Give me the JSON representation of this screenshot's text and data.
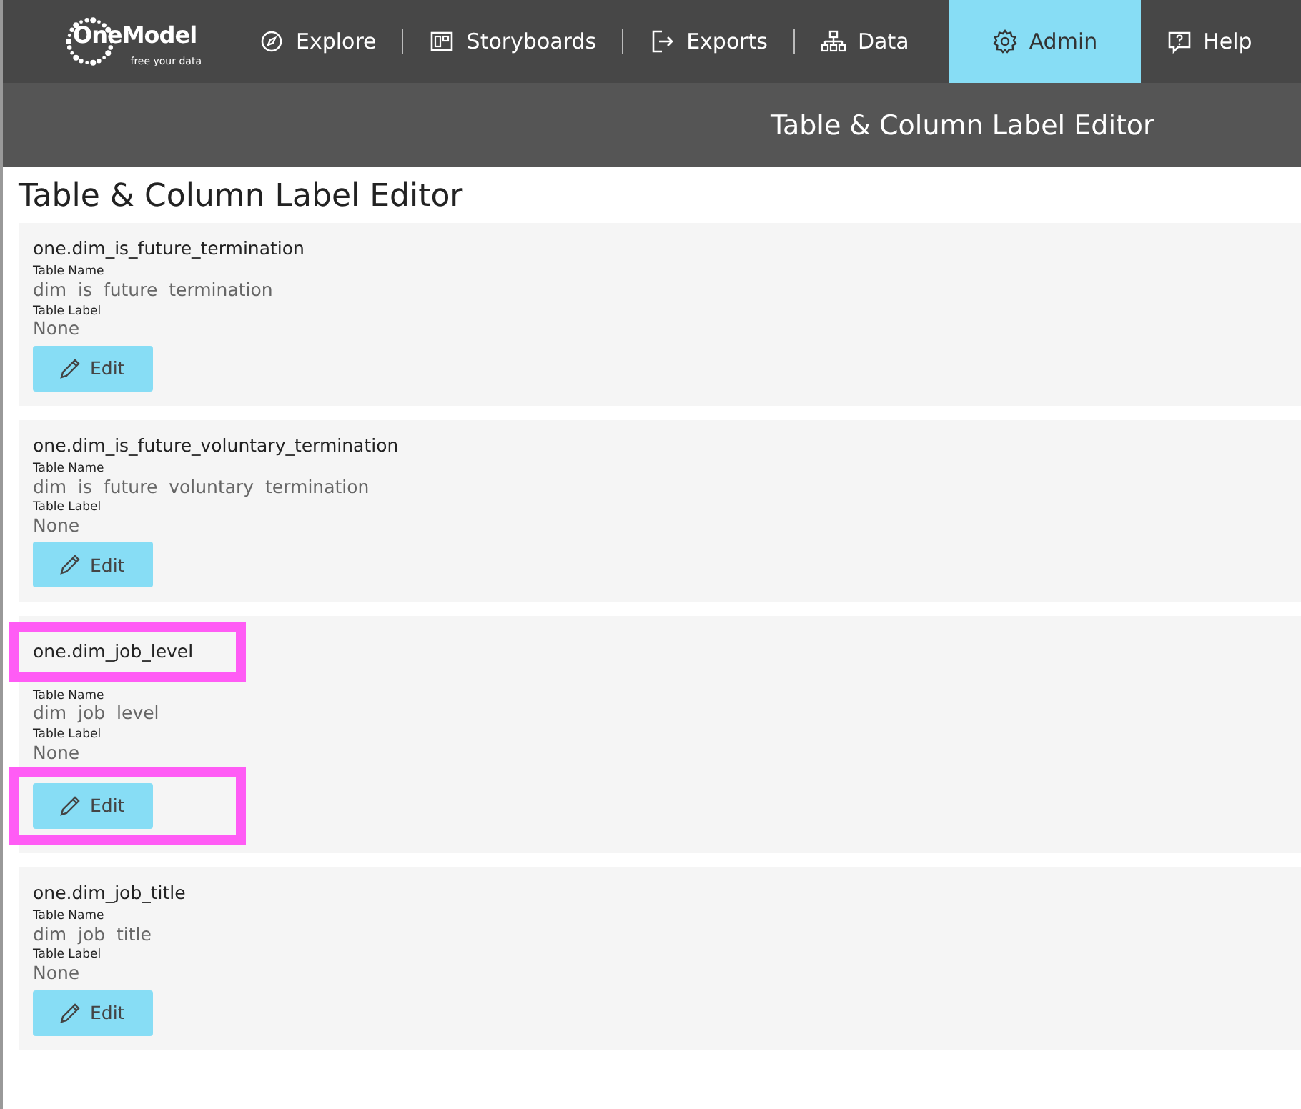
{
  "logo": {
    "name": "OneModel",
    "tagline": "free your data"
  },
  "nav": [
    {
      "label": "Explore",
      "selected": false
    },
    {
      "label": "Storyboards",
      "selected": false
    },
    {
      "label": "Exports",
      "selected": false
    },
    {
      "label": "Data",
      "selected": false
    },
    {
      "label": "Admin",
      "selected": true
    },
    {
      "label": "Help",
      "selected": false
    }
  ],
  "subheader": {
    "title": "Table & Column Label Editor"
  },
  "page_title": "Table & Column Label Editor",
  "cards": [
    {
      "title": "one.dim_is_future_termination",
      "name_label": "Table Name",
      "name": "dim  is  future  termination",
      "label_label": "Table Label",
      "label": "None",
      "button": "Edit",
      "highlighted": false
    },
    {
      "title": "one.dim_is_future_voluntary_termination",
      "name_label": "Table Name",
      "name": "dim  is  future  voluntary  termination",
      "label_label": "Table Label",
      "label": "None",
      "button": "Edit",
      "highlighted": false
    },
    {
      "title": "one.dim_job_level",
      "name_label": "Table Name",
      "name": "dim  job  level",
      "label_label": "Table Label",
      "label": "None",
      "button": "Edit",
      "highlighted": true
    },
    {
      "title": "one.dim_job_title",
      "name_label": "Table Name",
      "name": "dim  job  title",
      "label_label": "Table Label",
      "label": "None",
      "button": "Edit",
      "highlighted": false
    }
  ]
}
